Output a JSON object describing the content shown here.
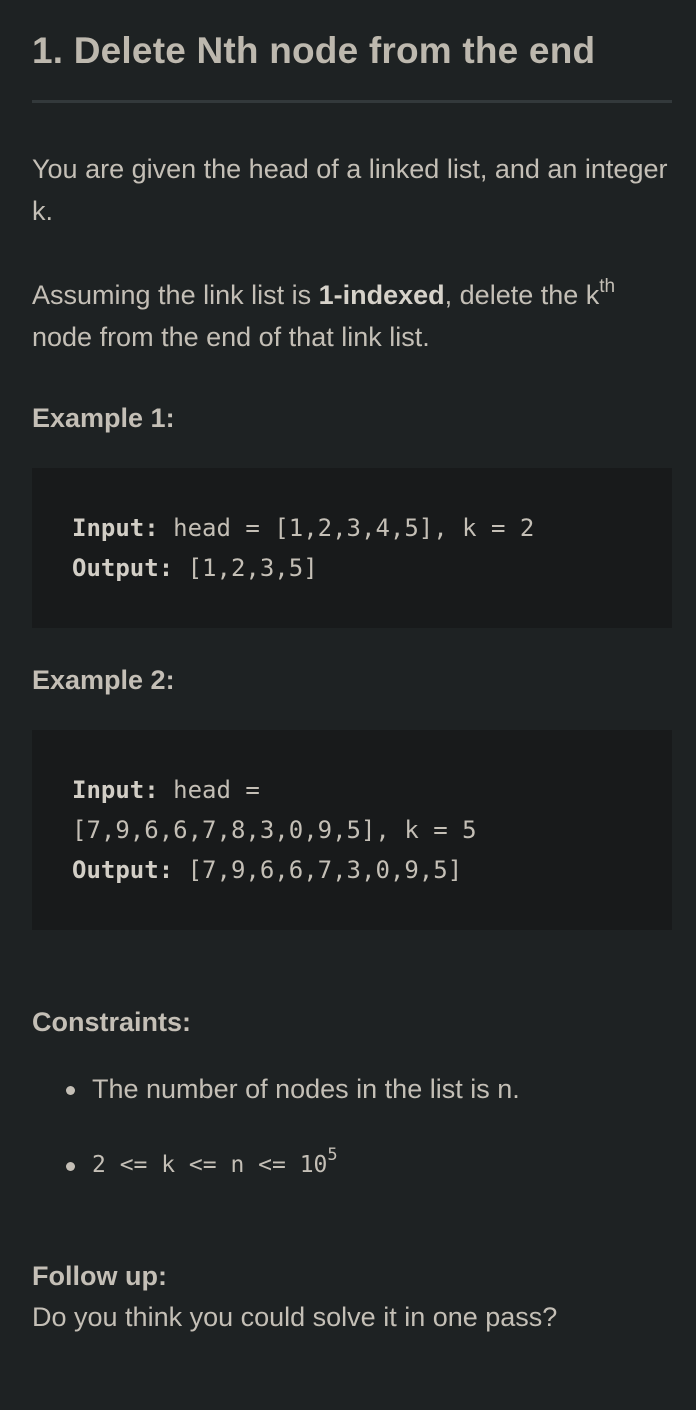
{
  "problem": {
    "title": "1. Delete Nth node from the end",
    "intro": "You are given the head of a linked list, and an integer k.",
    "desc_prefix": "Assuming the link list is ",
    "desc_bold": "1-indexed",
    "desc_mid": ", delete the k",
    "desc_sup": "th",
    "desc_suffix": " node from the end of that link list."
  },
  "examples": [
    {
      "heading": "Example 1:",
      "input_label": "Input:",
      "input_value": " head = [1,2,3,4,5], k = 2",
      "output_label": "Output:",
      "output_value": " [1,2,3,5]"
    },
    {
      "heading": "Example 2:",
      "input_label": "Input:",
      "input_value_line1": " head =",
      "input_value_line2": "[7,9,6,6,7,8,3,0,9,5], k = 5",
      "output_label": "Output:",
      "output_value": " [7,9,6,6,7,3,0,9,5]"
    }
  ],
  "constraints": {
    "heading": "Constraints:",
    "item1": "The number of nodes in the list is n.",
    "item2_text": "2 <= k <= n <= 10",
    "item2_sup": "5"
  },
  "follow_up": {
    "heading": "Follow up:",
    "text": "Do you think you could solve it in one pass?"
  }
}
